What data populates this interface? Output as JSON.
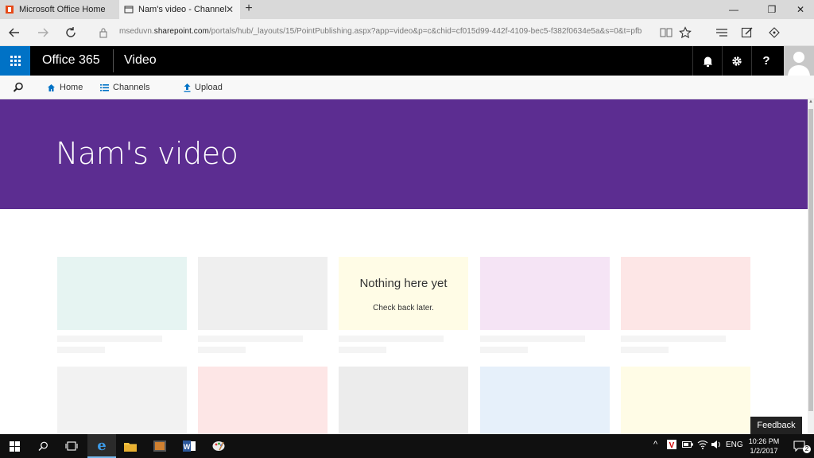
{
  "browser": {
    "tabs": [
      {
        "title": "Microsoft Office Home"
      },
      {
        "title": "Nam's video - Channel"
      }
    ],
    "url_prefix": "mseduvn.",
    "url_host": "sharepoint.com",
    "url_path": "/portals/hub/_layouts/15/PointPublishing.aspx?app=video&p=c&chid=cf015d99-442f-4109-bec5-f382f0634e5a&s=0&t=pfb"
  },
  "suite": {
    "brand": "Office 365",
    "app": "Video"
  },
  "commands": {
    "home": "Home",
    "channels": "Channels",
    "upload": "Upload"
  },
  "hero": {
    "title": "Nam's video",
    "color": "#5c2d91"
  },
  "empty_state": {
    "title": "Nothing here yet",
    "subtitle": "Check back later."
  },
  "placeholder_tiles": {
    "row1": [
      "#e6f4f2",
      "#efefef",
      "#fffce6",
      "#f5e4f5",
      "#fde6e6"
    ],
    "row2": [
      "#f2f2f2",
      "#fde6e6",
      "#ececec",
      "#e6f0fa",
      "#fffce6"
    ]
  },
  "feedback": "Feedback",
  "taskbar": {
    "language": "ENG",
    "time": "10:26 PM",
    "date": "1/2/2017",
    "notifications": "2"
  }
}
